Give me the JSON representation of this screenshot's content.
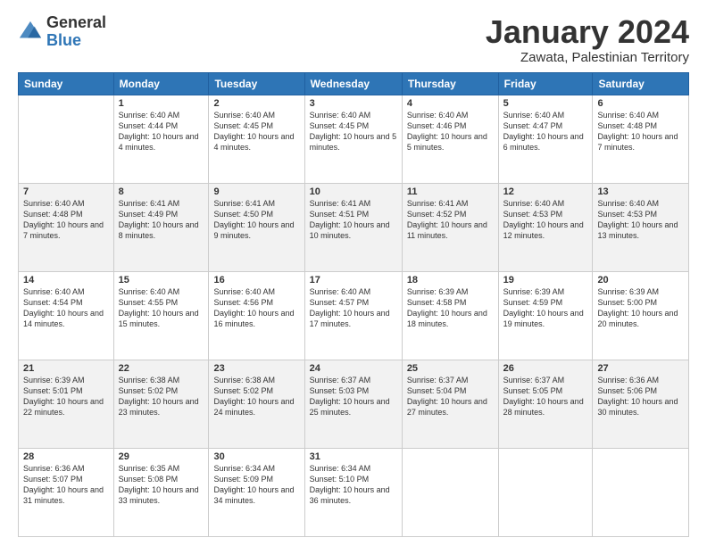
{
  "logo": {
    "general": "General",
    "blue": "Blue"
  },
  "header": {
    "month": "January 2024",
    "location": "Zawata, Palestinian Territory"
  },
  "days": [
    "Sunday",
    "Monday",
    "Tuesday",
    "Wednesday",
    "Thursday",
    "Friday",
    "Saturday"
  ],
  "weeks": [
    [
      {
        "day": "",
        "sunrise": "",
        "sunset": "",
        "daylight": ""
      },
      {
        "day": "1",
        "sunrise": "Sunrise: 6:40 AM",
        "sunset": "Sunset: 4:44 PM",
        "daylight": "Daylight: 10 hours and 4 minutes."
      },
      {
        "day": "2",
        "sunrise": "Sunrise: 6:40 AM",
        "sunset": "Sunset: 4:45 PM",
        "daylight": "Daylight: 10 hours and 4 minutes."
      },
      {
        "day": "3",
        "sunrise": "Sunrise: 6:40 AM",
        "sunset": "Sunset: 4:45 PM",
        "daylight": "Daylight: 10 hours and 5 minutes."
      },
      {
        "day": "4",
        "sunrise": "Sunrise: 6:40 AM",
        "sunset": "Sunset: 4:46 PM",
        "daylight": "Daylight: 10 hours and 5 minutes."
      },
      {
        "day": "5",
        "sunrise": "Sunrise: 6:40 AM",
        "sunset": "Sunset: 4:47 PM",
        "daylight": "Daylight: 10 hours and 6 minutes."
      },
      {
        "day": "6",
        "sunrise": "Sunrise: 6:40 AM",
        "sunset": "Sunset: 4:48 PM",
        "daylight": "Daylight: 10 hours and 7 minutes."
      }
    ],
    [
      {
        "day": "7",
        "sunrise": "Sunrise: 6:40 AM",
        "sunset": "Sunset: 4:48 PM",
        "daylight": "Daylight: 10 hours and 7 minutes."
      },
      {
        "day": "8",
        "sunrise": "Sunrise: 6:41 AM",
        "sunset": "Sunset: 4:49 PM",
        "daylight": "Daylight: 10 hours and 8 minutes."
      },
      {
        "day": "9",
        "sunrise": "Sunrise: 6:41 AM",
        "sunset": "Sunset: 4:50 PM",
        "daylight": "Daylight: 10 hours and 9 minutes."
      },
      {
        "day": "10",
        "sunrise": "Sunrise: 6:41 AM",
        "sunset": "Sunset: 4:51 PM",
        "daylight": "Daylight: 10 hours and 10 minutes."
      },
      {
        "day": "11",
        "sunrise": "Sunrise: 6:41 AM",
        "sunset": "Sunset: 4:52 PM",
        "daylight": "Daylight: 10 hours and 11 minutes."
      },
      {
        "day": "12",
        "sunrise": "Sunrise: 6:40 AM",
        "sunset": "Sunset: 4:53 PM",
        "daylight": "Daylight: 10 hours and 12 minutes."
      },
      {
        "day": "13",
        "sunrise": "Sunrise: 6:40 AM",
        "sunset": "Sunset: 4:53 PM",
        "daylight": "Daylight: 10 hours and 13 minutes."
      }
    ],
    [
      {
        "day": "14",
        "sunrise": "Sunrise: 6:40 AM",
        "sunset": "Sunset: 4:54 PM",
        "daylight": "Daylight: 10 hours and 14 minutes."
      },
      {
        "day": "15",
        "sunrise": "Sunrise: 6:40 AM",
        "sunset": "Sunset: 4:55 PM",
        "daylight": "Daylight: 10 hours and 15 minutes."
      },
      {
        "day": "16",
        "sunrise": "Sunrise: 6:40 AM",
        "sunset": "Sunset: 4:56 PM",
        "daylight": "Daylight: 10 hours and 16 minutes."
      },
      {
        "day": "17",
        "sunrise": "Sunrise: 6:40 AM",
        "sunset": "Sunset: 4:57 PM",
        "daylight": "Daylight: 10 hours and 17 minutes."
      },
      {
        "day": "18",
        "sunrise": "Sunrise: 6:39 AM",
        "sunset": "Sunset: 4:58 PM",
        "daylight": "Daylight: 10 hours and 18 minutes."
      },
      {
        "day": "19",
        "sunrise": "Sunrise: 6:39 AM",
        "sunset": "Sunset: 4:59 PM",
        "daylight": "Daylight: 10 hours and 19 minutes."
      },
      {
        "day": "20",
        "sunrise": "Sunrise: 6:39 AM",
        "sunset": "Sunset: 5:00 PM",
        "daylight": "Daylight: 10 hours and 20 minutes."
      }
    ],
    [
      {
        "day": "21",
        "sunrise": "Sunrise: 6:39 AM",
        "sunset": "Sunset: 5:01 PM",
        "daylight": "Daylight: 10 hours and 22 minutes."
      },
      {
        "day": "22",
        "sunrise": "Sunrise: 6:38 AM",
        "sunset": "Sunset: 5:02 PM",
        "daylight": "Daylight: 10 hours and 23 minutes."
      },
      {
        "day": "23",
        "sunrise": "Sunrise: 6:38 AM",
        "sunset": "Sunset: 5:02 PM",
        "daylight": "Daylight: 10 hours and 24 minutes."
      },
      {
        "day": "24",
        "sunrise": "Sunrise: 6:37 AM",
        "sunset": "Sunset: 5:03 PM",
        "daylight": "Daylight: 10 hours and 25 minutes."
      },
      {
        "day": "25",
        "sunrise": "Sunrise: 6:37 AM",
        "sunset": "Sunset: 5:04 PM",
        "daylight": "Daylight: 10 hours and 27 minutes."
      },
      {
        "day": "26",
        "sunrise": "Sunrise: 6:37 AM",
        "sunset": "Sunset: 5:05 PM",
        "daylight": "Daylight: 10 hours and 28 minutes."
      },
      {
        "day": "27",
        "sunrise": "Sunrise: 6:36 AM",
        "sunset": "Sunset: 5:06 PM",
        "daylight": "Daylight: 10 hours and 30 minutes."
      }
    ],
    [
      {
        "day": "28",
        "sunrise": "Sunrise: 6:36 AM",
        "sunset": "Sunset: 5:07 PM",
        "daylight": "Daylight: 10 hours and 31 minutes."
      },
      {
        "day": "29",
        "sunrise": "Sunrise: 6:35 AM",
        "sunset": "Sunset: 5:08 PM",
        "daylight": "Daylight: 10 hours and 33 minutes."
      },
      {
        "day": "30",
        "sunrise": "Sunrise: 6:34 AM",
        "sunset": "Sunset: 5:09 PM",
        "daylight": "Daylight: 10 hours and 34 minutes."
      },
      {
        "day": "31",
        "sunrise": "Sunrise: 6:34 AM",
        "sunset": "Sunset: 5:10 PM",
        "daylight": "Daylight: 10 hours and 36 minutes."
      },
      {
        "day": "",
        "sunrise": "",
        "sunset": "",
        "daylight": ""
      },
      {
        "day": "",
        "sunrise": "",
        "sunset": "",
        "daylight": ""
      },
      {
        "day": "",
        "sunrise": "",
        "sunset": "",
        "daylight": ""
      }
    ]
  ]
}
